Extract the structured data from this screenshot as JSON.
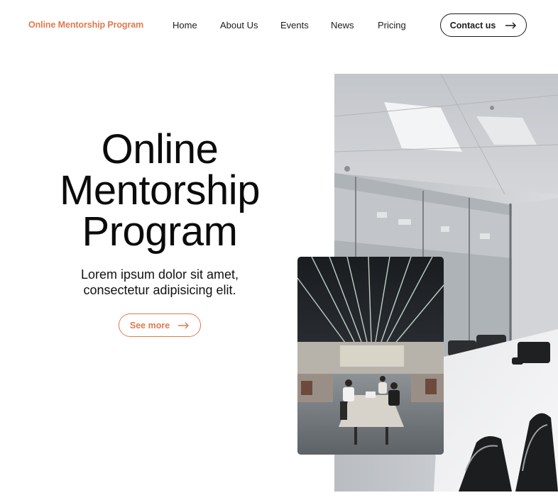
{
  "header": {
    "logo_text": "Online Mentorship Program",
    "nav": [
      "Home",
      "About Us",
      "Events",
      "News",
      "Pricing"
    ],
    "contact_label": "Contact us"
  },
  "hero": {
    "title_lines": [
      "Online",
      "Mentorship",
      "Program"
    ],
    "subtitle_lines": [
      "Lorem ipsum dolor sit amet,",
      "consectetur adipisicing elit."
    ],
    "cta_label": "See more"
  },
  "colors": {
    "accent": "#e07a4f",
    "text": "#0b0b0b"
  },
  "icons": {
    "cta_arrow": "arrow-right-icon"
  }
}
